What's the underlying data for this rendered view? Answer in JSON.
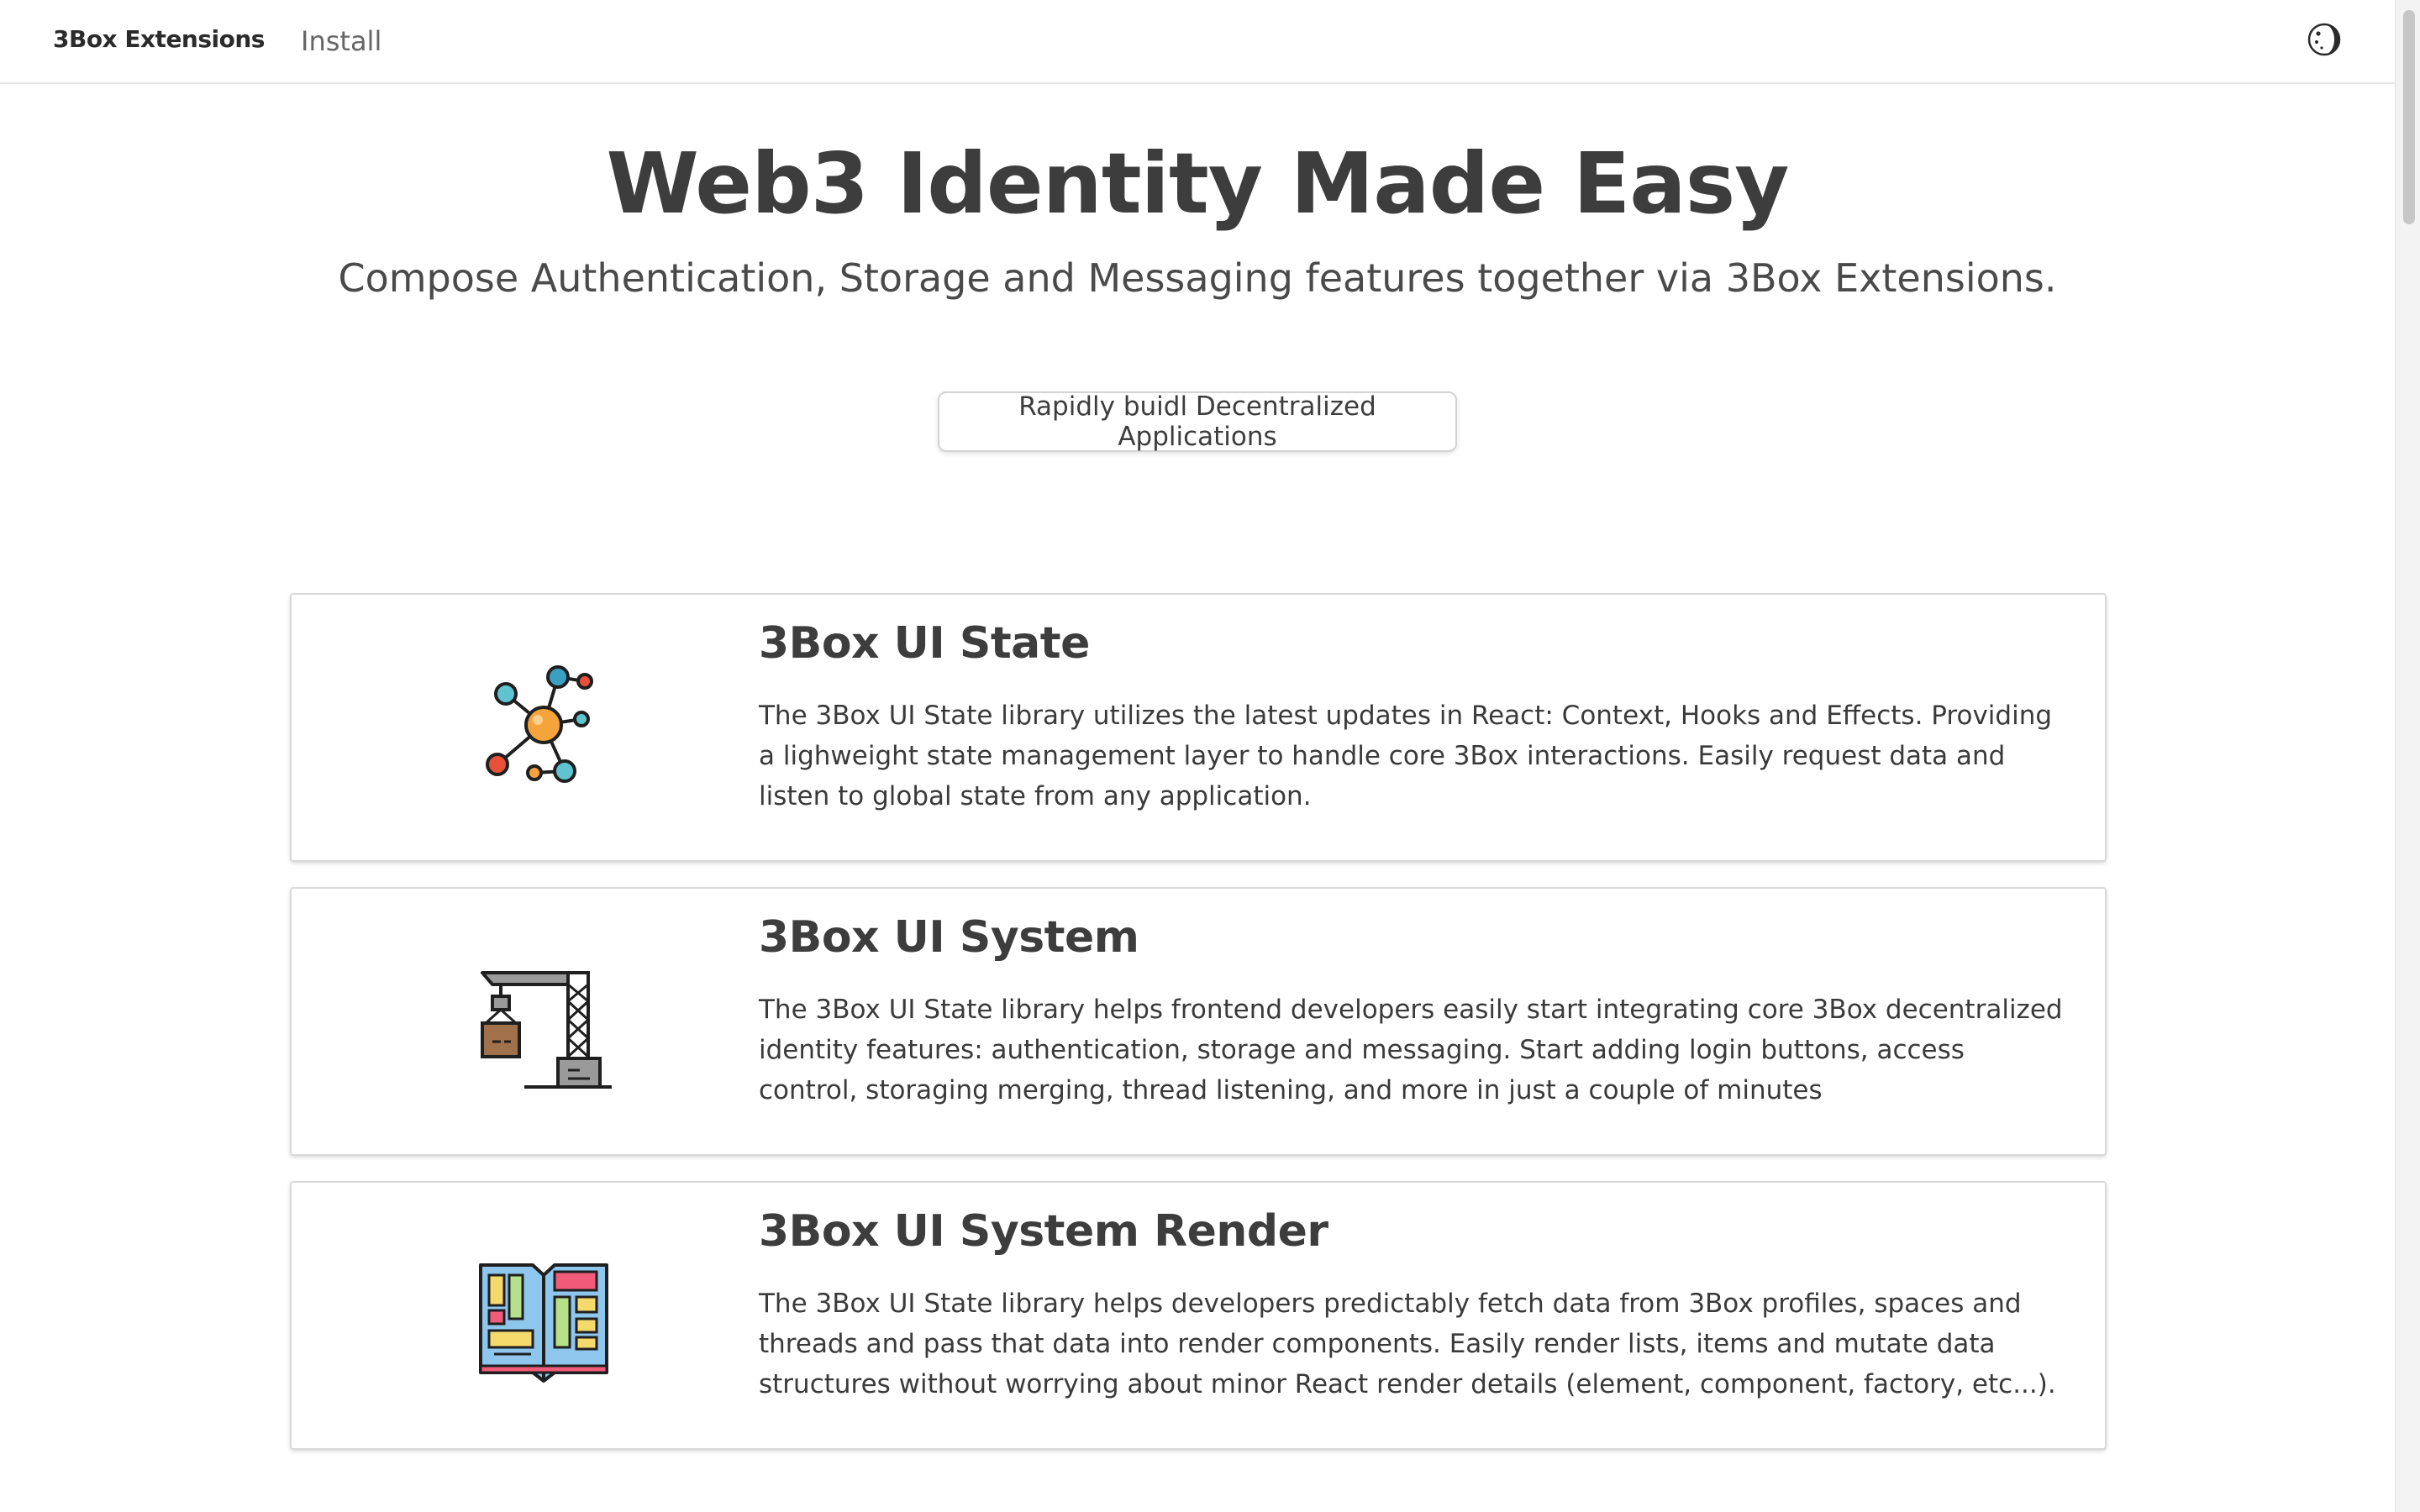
{
  "nav": {
    "brand": "3Box Extensions",
    "links": [
      "Install"
    ]
  },
  "hero": {
    "title": "Web3 Identity Made Easy",
    "subtitle": "Compose Authentication, Storage and Messaging features together via 3Box Extensions.",
    "cta_label": "Rapidly buidl Decentralized Applications"
  },
  "cards": [
    {
      "title": "3Box UI State",
      "icon": "network-nodes-icon",
      "description": "The 3Box UI State library utilizes the latest updates in React: Context, Hooks and Effects. Providing a lighweight state management layer to handle core 3Box interactions. Easily request data and listen to global state from any application."
    },
    {
      "title": "3Box UI System",
      "icon": "crane-icon",
      "description": "The 3Box UI State library helps frontend developers easily start integrating core 3Box decentralized identity features: authentication, storage and messaging. Start adding login buttons, access control, storaging merging, thread listening, and more in just a couple of minutes"
    },
    {
      "title": "3Box UI System Render",
      "icon": "layout-book-icon",
      "description": "The 3Box UI State library helps developers predictably fetch data from 3Box profiles, spaces and threads and pass that data into render components. Easily render lists, items and mutate data structures without worrying about minor React render details (element, component, factory, etc...)."
    }
  ],
  "colors": {
    "text": "#3d3d3d",
    "border": "#d9d9d9",
    "icon_orange": "#f5a33b",
    "icon_teal": "#5fc4d0",
    "icon_red": "#e8503a",
    "icon_brown": "#a0714b",
    "icon_pink": "#ef5b79",
    "icon_blue": "#8ec6ee",
    "icon_green": "#b7e08a",
    "icon_yellow": "#f4d96b"
  }
}
